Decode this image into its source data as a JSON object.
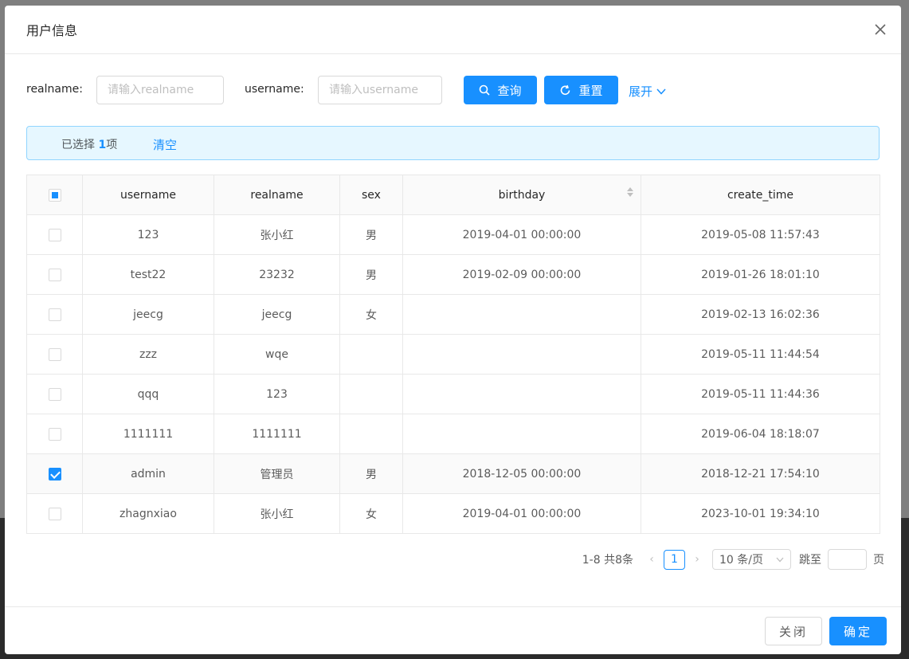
{
  "modal": {
    "title": "用户信息"
  },
  "search": {
    "realname_label": "realname:",
    "realname_placeholder": "请输入realname",
    "username_label": "username:",
    "username_placeholder": "请输入username",
    "query_label": "查询",
    "reset_label": "重置",
    "expand_label": "展开"
  },
  "alert": {
    "prefix": "已选择 ",
    "count": "1",
    "suffix": "项",
    "clear_label": "清空"
  },
  "table": {
    "columns": [
      "username",
      "realname",
      "sex",
      "birthday",
      "create_time"
    ],
    "rows": [
      {
        "username": "123",
        "realname": "张小红",
        "sex": "男",
        "birthday": "2019-04-01 00:00:00",
        "create_time": "2019-05-08 11:57:43",
        "selected": false
      },
      {
        "username": "test22",
        "realname": "23232",
        "sex": "男",
        "birthday": "2019-02-09 00:00:00",
        "create_time": "2019-01-26 18:01:10",
        "selected": false
      },
      {
        "username": "jeecg",
        "realname": "jeecg",
        "sex": "女",
        "birthday": "",
        "create_time": "2019-02-13 16:02:36",
        "selected": false
      },
      {
        "username": "zzz",
        "realname": "wqe",
        "sex": "",
        "birthday": "",
        "create_time": "2019-05-11 11:44:54",
        "selected": false
      },
      {
        "username": "qqq",
        "realname": "123",
        "sex": "",
        "birthday": "",
        "create_time": "2019-05-11 11:44:36",
        "selected": false
      },
      {
        "username": "1111111",
        "realname": "1111111",
        "sex": "",
        "birthday": "",
        "create_time": "2019-06-04 18:18:07",
        "selected": false
      },
      {
        "username": "admin",
        "realname": "管理员",
        "sex": "男",
        "birthday": "2018-12-05 00:00:00",
        "create_time": "2018-12-21 17:54:10",
        "selected": true
      },
      {
        "username": "zhagnxiao",
        "realname": "张小红",
        "sex": "女",
        "birthday": "2019-04-01 00:00:00",
        "create_time": "2023-10-01 19:34:10",
        "selected": false
      }
    ]
  },
  "pagination": {
    "total_text": "1-8 共8条",
    "current_page": "1",
    "page_size": "10 条/页",
    "jump_label": "跳至",
    "page_suffix": "页"
  },
  "footer": {
    "close_label": "关闭",
    "ok_label": "确定"
  },
  "colors": {
    "primary": "#1890ff",
    "alert_bg": "#e6f7ff",
    "alert_border": "#91d5ff"
  }
}
